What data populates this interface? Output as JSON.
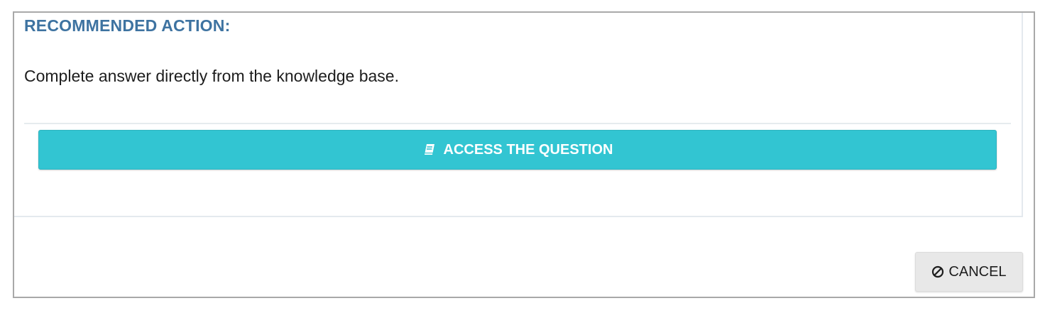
{
  "panel": {
    "heading": "RECOMMENDED ACTION:",
    "description": "Complete answer directly from the knowledge base."
  },
  "actions": {
    "access_label": "ACCESS THE QUESTION",
    "access_icon": "book-icon",
    "cancel_label": "CANCEL",
    "cancel_icon": "ban-icon"
  },
  "colors": {
    "heading": "#3e73a1",
    "primary_button": "#32c5d2",
    "secondary_button": "#e8e8e8"
  }
}
